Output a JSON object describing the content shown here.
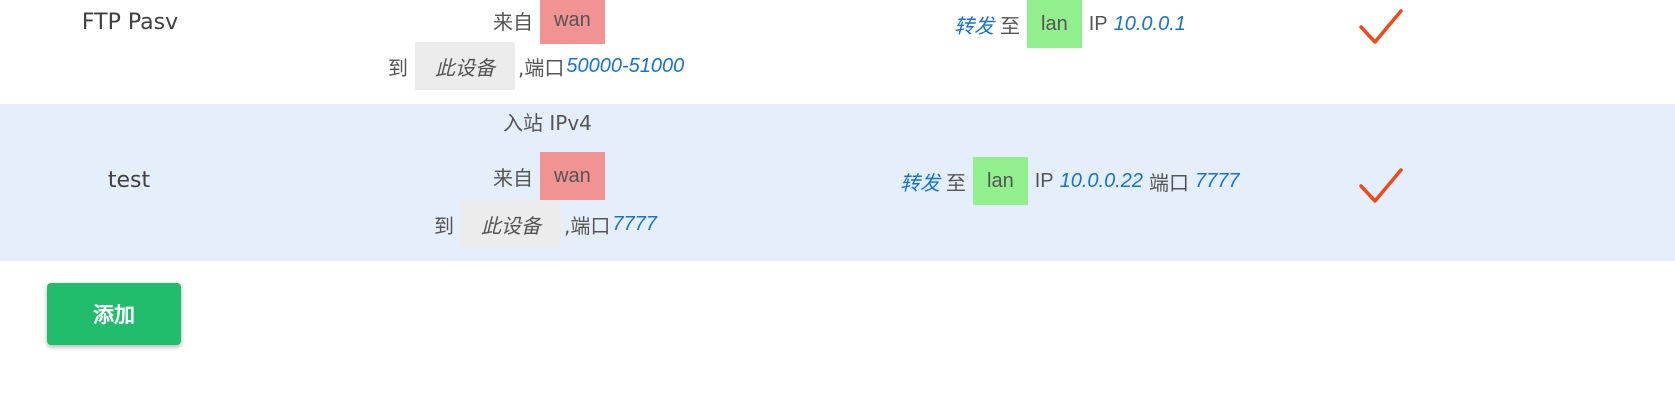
{
  "rules": [
    {
      "name": "FTP Pasv",
      "from_label": "来自",
      "from_zone": "wan",
      "to_label": "到",
      "to_target": "此设备",
      "port_label": ",端口",
      "port": "50000-51000",
      "action": "转发",
      "action_to": "至",
      "dest_zone": "lan",
      "ip_label": "IP",
      "dest_ip": "10.0.0.1",
      "enabled": true
    },
    {
      "name": "test",
      "direction": "入站 IPv4",
      "from_label": "来自",
      "from_zone": "wan",
      "to_label": "到",
      "to_target": "此设备",
      "port_label": ",端口",
      "port": "7777",
      "action": "转发",
      "action_to": "至",
      "dest_zone": "lan",
      "ip_label": "IP",
      "dest_ip": "10.0.0.22",
      "dest_port_label": "端口",
      "dest_port": "7777",
      "enabled": true
    }
  ],
  "add_button": "添加",
  "colors": {
    "wan": "#f19393",
    "lan": "#92ef8e",
    "device": "#ececec",
    "link": "#1673d2",
    "check": "#f04a1a",
    "row_alt": "#e5effc",
    "button": "#21bd6d"
  },
  "icons": {
    "enabled": "check-icon"
  }
}
